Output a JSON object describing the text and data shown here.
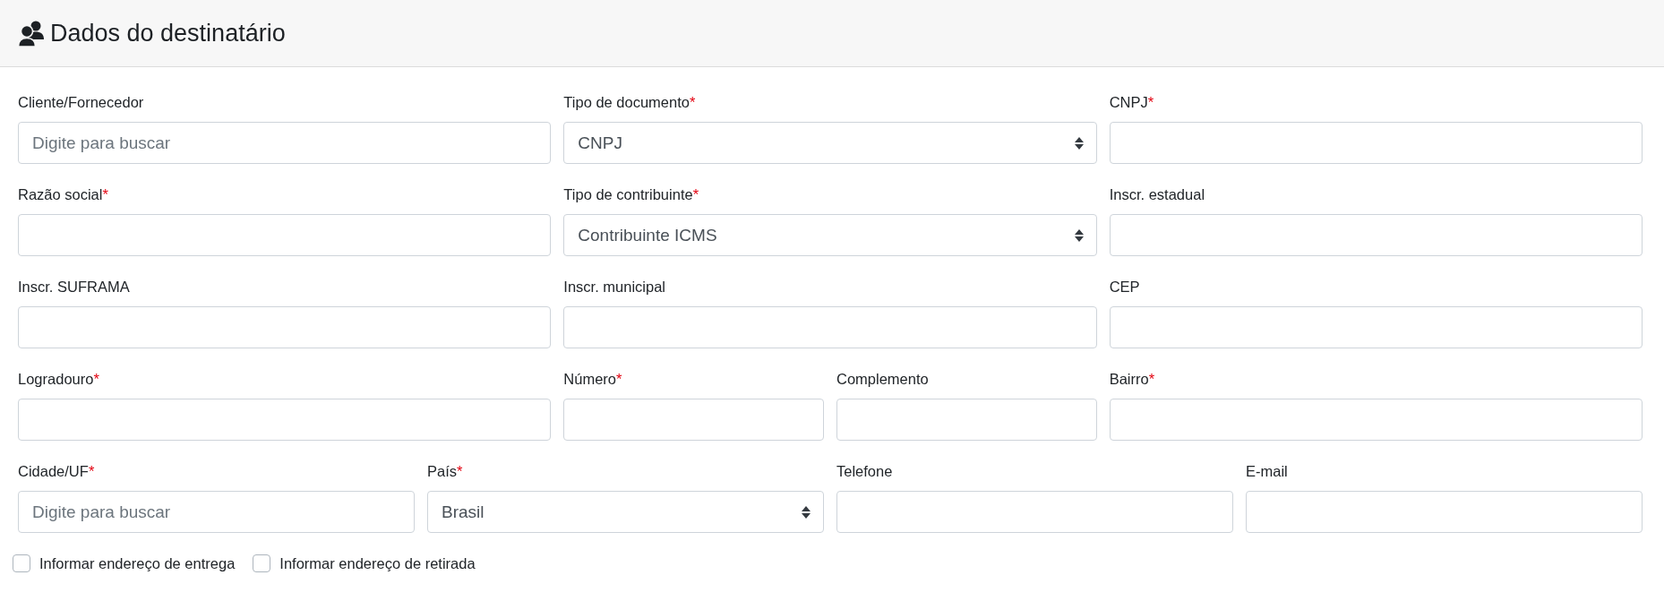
{
  "header": {
    "title": "Dados do destinatário"
  },
  "rows": [
    {
      "fields": [
        {
          "label": "Cliente/Fornecedor",
          "kind": "text",
          "placeholder": "Digite para buscar"
        },
        {
          "label": "Tipo de documento",
          "required_mark": "*",
          "kind": "select",
          "value": "CNPJ"
        },
        {
          "label": "CNPJ",
          "required_mark": "*",
          "kind": "text"
        }
      ]
    },
    {
      "fields": [
        {
          "label": "Razão social",
          "required_mark": "*",
          "kind": "text"
        },
        {
          "label": "Tipo de contribuinte",
          "required_mark": "*",
          "kind": "select",
          "value": "Contribuinte ICMS"
        },
        {
          "label": "Inscr. estadual",
          "kind": "text"
        }
      ]
    },
    {
      "fields": [
        {
          "label": "Inscr. SUFRAMA",
          "kind": "text"
        },
        {
          "label": "Inscr. municipal",
          "kind": "text"
        },
        {
          "label": "CEP",
          "kind": "text"
        }
      ]
    },
    {
      "fields": [
        {
          "label": "Logradouro",
          "required_mark": "*",
          "kind": "text"
        },
        {
          "label": "Número",
          "required_mark": "*",
          "kind": "text"
        },
        {
          "label": "Complemento",
          "kind": "text"
        },
        {
          "label": "Bairro",
          "required_mark": "*",
          "kind": "text"
        }
      ]
    },
    {
      "fields": [
        {
          "label": "Cidade/UF",
          "required_mark": "*",
          "kind": "text",
          "placeholder": "Digite para buscar"
        },
        {
          "label": "País",
          "required_mark": "*",
          "kind": "select",
          "value": "Brasil"
        },
        {
          "label": "Telefone",
          "kind": "text"
        },
        {
          "label": "E-mail",
          "kind": "text"
        }
      ]
    }
  ],
  "checkboxes": [
    {
      "label": "Informar endereço de entrega",
      "checked": false
    },
    {
      "label": "Informar endereço de retirada",
      "checked": false
    }
  ]
}
